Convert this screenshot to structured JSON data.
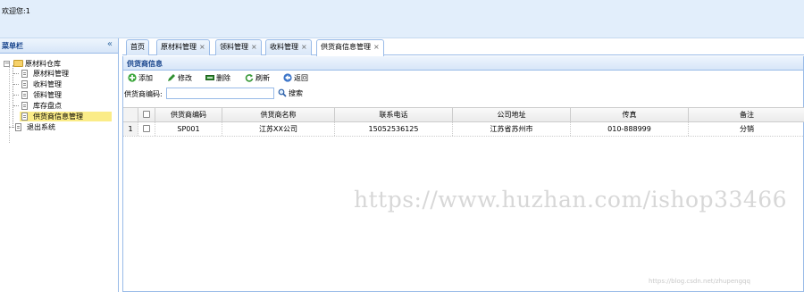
{
  "header": {
    "welcome": "欢迎您:1"
  },
  "menu": {
    "title": "菜单栏",
    "collapse_icon": "«",
    "tree": {
      "root_label": "原材料仓库",
      "children": [
        "原材料管理",
        "收料管理",
        "领料管理",
        "库存盘点",
        "供货商信息管理"
      ],
      "selected": "供货商信息管理",
      "exit_label": "退出系统"
    }
  },
  "tabs": [
    {
      "label": "首页",
      "closable": false
    },
    {
      "label": "原材料管理",
      "closable": true
    },
    {
      "label": "领料管理",
      "closable": true
    },
    {
      "label": "收料管理",
      "closable": true
    },
    {
      "label": "供货商信息管理",
      "closable": true,
      "active": true
    }
  ],
  "tab_close_glyph": "×",
  "panel": {
    "title": "供货商信息",
    "toolbar": {
      "add": "添加",
      "edit": "修改",
      "delete": "删除",
      "refresh": "刷新",
      "back": "返回"
    },
    "search": {
      "label": "供货商编码:",
      "value": "",
      "placeholder": "",
      "button": "搜索"
    },
    "grid": {
      "columns": [
        "",
        "",
        "供货商编码",
        "供货商名称",
        "联系电话",
        "公司地址",
        "传真",
        "备注"
      ],
      "rows": [
        {
          "num": "1",
          "code": "SP001",
          "name": "江苏XX公司",
          "phone": "15052536125",
          "address": "江苏省苏州市",
          "fax": "010-888999",
          "note": "分销"
        }
      ]
    }
  },
  "watermark": "https://www.huzhan.com/ishop33466",
  "credit": "https://blog.csdn.net/zhupengqq",
  "colors": {
    "header_bg": "#e2eefb",
    "border": "#99bbe8",
    "selected": "#fbec88",
    "title_text": "#15428b"
  }
}
